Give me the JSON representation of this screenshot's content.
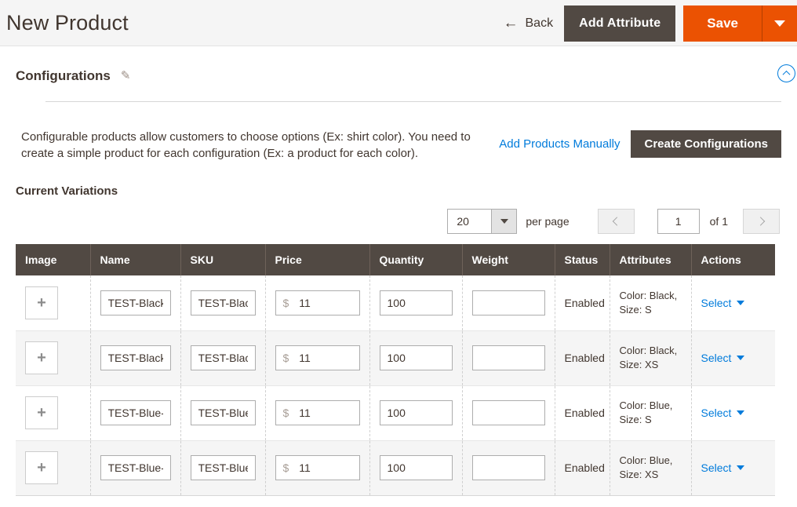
{
  "header": {
    "title": "New Product",
    "back_label": "Back",
    "back_icon": "arrow-left-icon",
    "add_attribute_label": "Add Attribute",
    "save_label": "Save",
    "save_menu_icon": "caret-down-icon",
    "primary_color": "#eb5202",
    "secondary_color": "#514943"
  },
  "section": {
    "title": "Configurations",
    "edit_icon": "pencil-icon",
    "collapse_icon": "chevron-up-circle-icon"
  },
  "intro": {
    "text": "Configurable products allow customers to choose options (Ex: shirt color). You need to create a simple product for each configuration (Ex: a product for each color).",
    "add_manually_label": "Add Products Manually",
    "create_configurations_label": "Create Configurations",
    "link_color": "#007bdb"
  },
  "variations": {
    "label": "Current Variations"
  },
  "pager": {
    "per_page_value": "20",
    "per_page_label": "per page",
    "per_page_caret_icon": "caret-down-icon",
    "prev_icon": "chevron-left-icon",
    "next_icon": "chevron-right-icon",
    "page_value": "1",
    "of_label": "of 1"
  },
  "table": {
    "columns": [
      "Image",
      "Name",
      "SKU",
      "Price",
      "Quantity",
      "Weight",
      "Status",
      "Attributes",
      "Actions"
    ],
    "add_image_icon": "plus-icon",
    "price_symbol": "$",
    "action_label": "Select",
    "action_caret_icon": "caret-down-icon",
    "rows": [
      {
        "name": "TEST-Black",
        "sku": "TEST-Black",
        "price": "11",
        "quantity": "100",
        "weight": "",
        "status": "Enabled",
        "attributes": "Color: Black, Size: S"
      },
      {
        "name": "TEST-Black",
        "sku": "TEST-Black",
        "price": "11",
        "quantity": "100",
        "weight": "",
        "status": "Enabled",
        "attributes": "Color: Black, Size: XS"
      },
      {
        "name": "TEST-Blue-S",
        "sku": "TEST-Blue-S",
        "price": "11",
        "quantity": "100",
        "weight": "",
        "status": "Enabled",
        "attributes": "Color: Blue, Size: S"
      },
      {
        "name": "TEST-Blue-XS",
        "sku": "TEST-Blue-XS",
        "price": "11",
        "quantity": "100",
        "weight": "",
        "status": "Enabled",
        "attributes": "Color: Blue, Size: XS"
      }
    ]
  }
}
